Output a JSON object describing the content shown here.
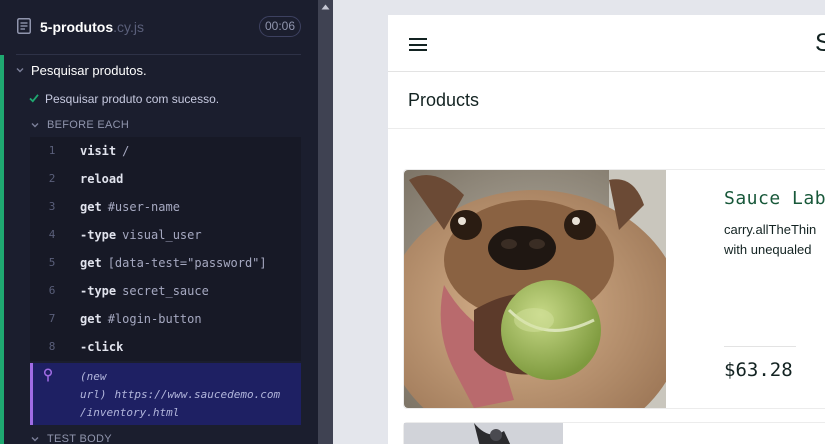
{
  "spec": {
    "name": "5-produtos",
    "ext": ".cy.js",
    "duration": "00:06"
  },
  "suite": {
    "title": "Pesquisar produtos."
  },
  "test": {
    "title": "Pesquisar produto com sucesso.",
    "status": "passed"
  },
  "hooks": {
    "before_each": "BEFORE EACH",
    "test_body": "TEST BODY"
  },
  "commands": [
    {
      "num": "1",
      "name": "visit",
      "arg": "/"
    },
    {
      "num": "2",
      "name": "reload",
      "arg": ""
    },
    {
      "num": "3",
      "name": "get",
      "arg": "#user-name"
    },
    {
      "num": "4",
      "name": "-type",
      "arg": "visual_user"
    },
    {
      "num": "5",
      "name": "get",
      "arg": "[data-test=\"password\"]"
    },
    {
      "num": "6",
      "name": "-type",
      "arg": "secret_sauce"
    },
    {
      "num": "7",
      "name": "get",
      "arg": "#login-button"
    },
    {
      "num": "8",
      "name": "-click",
      "arg": ""
    }
  ],
  "url_change": {
    "label_line1": "(new",
    "label_line2": "url)",
    "url": "https://www.saucedemo.com",
    "url_cont": "/inventory.html"
  },
  "app": {
    "logo": "S",
    "page_title": "Products",
    "item": {
      "name": "Sauce Lab",
      "desc_line1": "carry.allTheThin",
      "desc_line2": "with unequaled",
      "price": "$63.28"
    }
  },
  "colors": {
    "pass": "#1fa971",
    "url_highlight": "#1e2063",
    "url_marker": "#a06ce4",
    "item_name": "#18583a"
  }
}
